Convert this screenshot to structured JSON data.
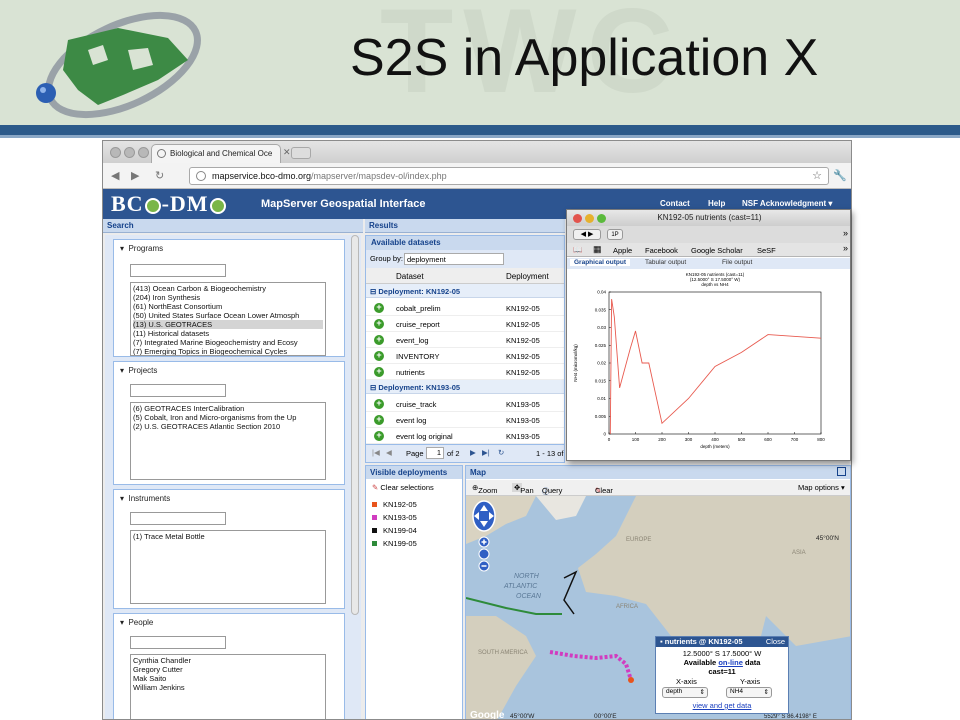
{
  "slide": {
    "title": "S2S in Application X",
    "watermark": "TWC"
  },
  "browser": {
    "tab_title": "Biological and Chemical Oce",
    "url_domain": "mapservice.bco-dmo.org",
    "url_path": "/mapserver/mapsdev-ol/index.php"
  },
  "app": {
    "logo_left": "BC",
    "logo_mid": "-DM",
    "subtitle": "MapServer Geospatial Interface",
    "nav": [
      "Contact",
      "Help",
      "NSF Acknowledgment ▾"
    ]
  },
  "search": {
    "title": "Search",
    "facets": [
      {
        "label": "Programs",
        "items": [
          "(413) Ocean Carbon & Biogeochemistry",
          "(204) Iron Synthesis",
          "(61) NorthEast Consortium",
          "(50) United States Surface Ocean Lower Atmosph",
          "(13) U.S. GEOTRACES",
          "(11) Historical datasets",
          "(7) Integrated Marine Biogeochemistry and Ecosy",
          "(7) Emerging Topics in Biogeochemical Cycles"
        ],
        "selected": 4
      },
      {
        "label": "Projects",
        "items": [
          "(6) GEOTRACES InterCalibration",
          "(5) Cobalt, Iron and Micro-organisms from the Up",
          "(2) U.S. GEOTRACES Atlantic Section 2010"
        ],
        "selected": -1
      },
      {
        "label": "Instruments",
        "items": [
          "(1) Trace Metal Bottle"
        ],
        "selected": -1
      },
      {
        "label": "People",
        "items": [
          "Cynthia Chandler",
          "Gregory Cutter",
          "Mak Saito",
          "William Jenkins"
        ],
        "selected": -1
      }
    ]
  },
  "results": {
    "title": "Results",
    "subtitle": "Available datasets",
    "group_by_label": "Group by:",
    "group_by_value": "deployment",
    "columns": [
      "Dataset",
      "Deployment"
    ],
    "groups": [
      {
        "label": "Deployment: KN192-05",
        "rows": [
          [
            "cobalt_prelim",
            "KN192-05"
          ],
          [
            "cruise_report",
            "KN192-05"
          ],
          [
            "event_log",
            "KN192-05"
          ],
          [
            "INVENTORY",
            "KN192-05"
          ],
          [
            "nutrients",
            "KN192-05"
          ]
        ]
      },
      {
        "label": "Deployment: KN193-05",
        "rows": [
          [
            "cruise_track",
            "KN193-05"
          ],
          [
            "event log",
            "KN193-05"
          ],
          [
            "event log original",
            "KN193-05"
          ]
        ]
      }
    ],
    "pager": {
      "page_label": "Page",
      "page": "1",
      "of": "of 2",
      "range": "1 - 13 of"
    }
  },
  "visible": {
    "title": "Visible deployments",
    "clear": "Clear selections",
    "items": [
      {
        "name": "KN192-05",
        "color": "#e8541c"
      },
      {
        "name": "KN193-05",
        "color": "#d13cc0"
      },
      {
        "name": "KN199-04",
        "color": "#111111"
      },
      {
        "name": "KN199-05",
        "color": "#2e8b3a"
      }
    ]
  },
  "map": {
    "title": "Map",
    "tools": [
      "Zoom in",
      "Pan",
      "Query map",
      "Clear query"
    ],
    "options": "Map options ▾",
    "labels": {
      "north": "NORTH",
      "atlantic": "ATLANTIC",
      "ocean": "OCEAN",
      "europe": "EUROPE",
      "asia": "ASIA",
      "africa": "AFRICA",
      "south_america": "SOUTH AMERICA"
    },
    "lat_right": "45°00'N",
    "lon_bottom_left": "45°00'W",
    "lon_bottom_mid": "00°00'E",
    "coord_readout": "5529° S 86.4198° E",
    "google": "Google",
    "popup": {
      "head": "nutrients @ KN192-05",
      "close": "Close",
      "coords": "12.5000° S 17.5000° W",
      "avail_pre": "Available",
      "avail_link": "on-line",
      "avail_post": "data",
      "cast": "cast=11",
      "xaxis_label": "X-axis",
      "yaxis_label": "Y-axis",
      "xaxis_value": "depth",
      "yaxis_value": "NH4",
      "link": "view and get data"
    }
  },
  "graph_window": {
    "title": "KN192-05 nutrients (cast=11)",
    "bookmarks": [
      "Apple",
      "Facebook",
      "Google Scholar",
      "SeSF"
    ],
    "tabs": [
      "Graphical output",
      "Tabular output",
      "File output"
    ]
  },
  "chart_data": {
    "type": "line",
    "title": "KN192-05 nutrients (cast=11)",
    "subtitle": "(12.5000° S 17.5000° W)",
    "subtitle2": "depth vs NH4",
    "xlabel": "depth (meters)",
    "ylabel": "NH4 (micromol/kg)",
    "xlim": [
      0,
      800
    ],
    "ylim": [
      0,
      0.04
    ],
    "xticks": [
      0,
      100,
      200,
      300,
      400,
      500,
      600,
      700,
      800
    ],
    "yticks": [
      0,
      0.005,
      0.01,
      0.015,
      0.02,
      0.025,
      0.03,
      0.035,
      0.04
    ],
    "series": [
      {
        "color": "#e85a4f",
        "x": [
          5,
          10,
          20,
          40,
          80,
          100,
          125,
          150,
          200,
          300,
          400,
          500,
          600,
          800
        ],
        "y": [
          0.0,
          0.038,
          0.033,
          0.013,
          0.024,
          0.029,
          0.02,
          0.02,
          0.003,
          0.01,
          0.019,
          0.023,
          0.028,
          0.027
        ]
      }
    ]
  }
}
